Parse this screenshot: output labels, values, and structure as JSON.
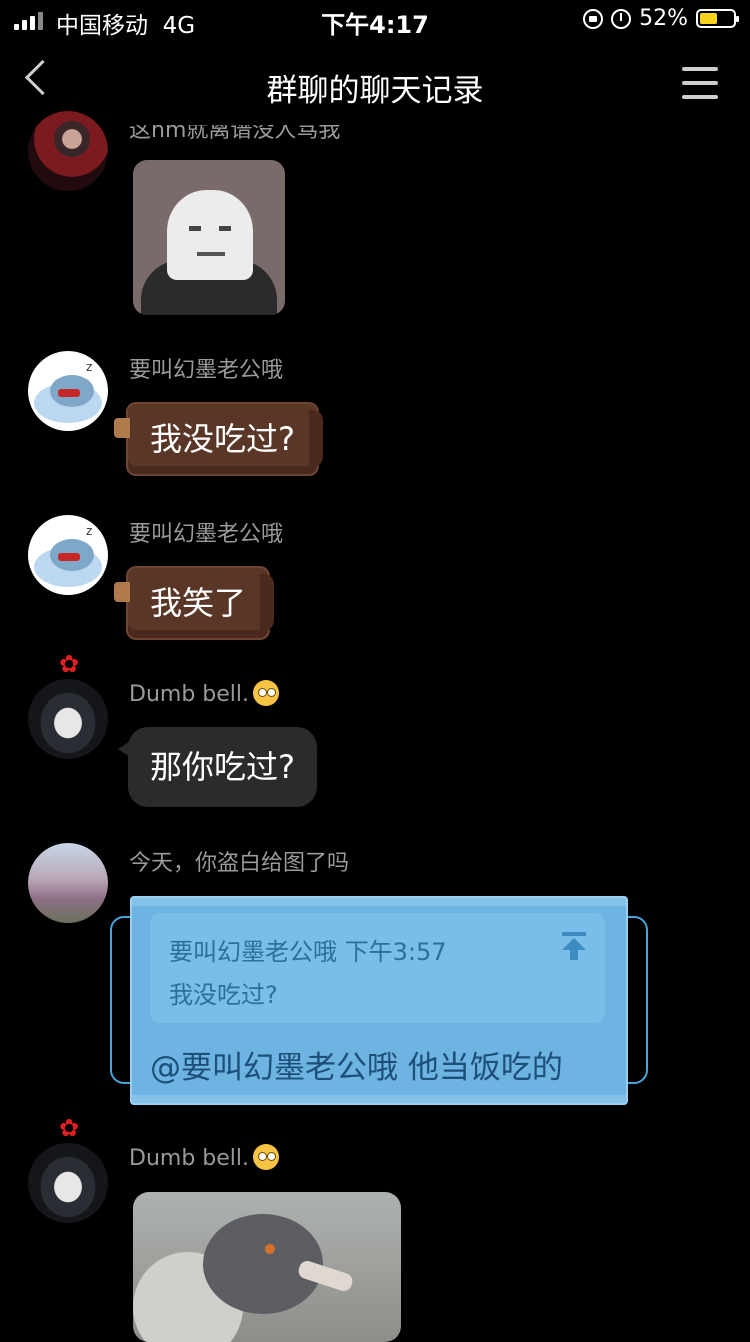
{
  "status_bar": {
    "carrier": "中国移动",
    "network": "4G",
    "time": "下午4:17",
    "battery": "52%",
    "battery_level": 0.52
  },
  "nav": {
    "title": "群聊的聊天记录"
  },
  "messages": [
    {
      "sender": "",
      "partial_text": "这nm就离谱没人骂我",
      "type": "image",
      "image": "meme-face"
    },
    {
      "sender": "要叫幻墨老公哦",
      "type": "text",
      "text": "我没吃过?"
    },
    {
      "sender": "要叫幻墨老公哦",
      "type": "text",
      "text": "我笑了"
    },
    {
      "sender": "Dumb bell.",
      "type": "text",
      "text": "那你吃过?"
    },
    {
      "sender": "今天，你盗白给图了吗",
      "type": "reply",
      "quote": {
        "sender": "要叫幻墨老公哦",
        "time": "下午3:57",
        "text": "我没吃过?"
      },
      "text": "@要叫幻墨老公哦 他当饭吃的"
    },
    {
      "sender": "Dumb bell.",
      "type": "image",
      "image": "pigeon"
    }
  ],
  "colors": {
    "background": "#000000",
    "choco_bubble": "#5a3627",
    "dark_bubble": "#2b2b2b",
    "mask_bubble": "#6db4e3",
    "battery": "#f4d21d"
  }
}
